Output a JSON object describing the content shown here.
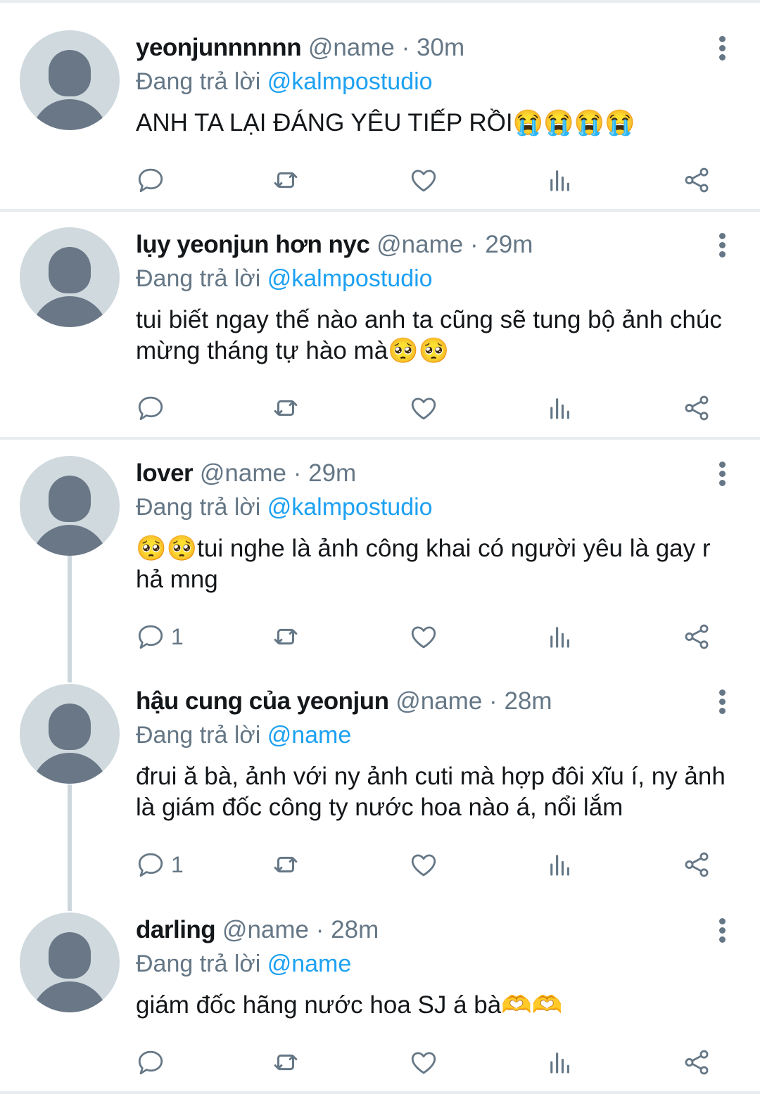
{
  "tweets": [
    {
      "name": "yeonjunnnnnn",
      "handle": "@name",
      "time": "30m",
      "reply_prefix": "Đang trả lời",
      "reply_to": "@kalmpostudio",
      "text": "ANH TA LẠI ĐÁNG YÊU TIẾP RỒI😭😭😭😭",
      "reply_count": ""
    },
    {
      "name": "lụy yeonjun hơn nyc",
      "handle": "@name",
      "time": "29m",
      "reply_prefix": "Đang trả lời",
      "reply_to": "@kalmpostudio",
      "text": "tui biết ngay thế nào anh ta cũng sẽ tung bộ ảnh chúc mừng tháng tự hào mà🥺🥺",
      "reply_count": ""
    },
    {
      "name": "lover",
      "handle": "@name",
      "time": "29m",
      "reply_prefix": "Đang trả lời",
      "reply_to": "@kalmpostudio",
      "text": "🥺🥺tui nghe là ảnh công khai có người yêu là gay r hả mng",
      "reply_count": "1"
    },
    {
      "name": "hậu cung của yeonjun",
      "handle": "@name",
      "time": "28m",
      "reply_prefix": "Đang trả lời",
      "reply_to": "@name",
      "text": "đrui ă bà, ảnh với ny ảnh cuti mà hợp đôi xĩu í, ny ảnh là giám đốc công ty nước hoa nào á, nổi lắm",
      "reply_count": "1"
    },
    {
      "name": "darling",
      "handle": "@name",
      "time": "28m",
      "reply_prefix": "Đang trả lời",
      "reply_to": "@name",
      "text": "giám đốc hãng nước hoa SJ á bà🫶🫶",
      "reply_count": ""
    }
  ],
  "separator": "·",
  "icons": [
    "reply-icon",
    "retweet-icon",
    "like-icon",
    "analytics-icon",
    "share-icon",
    "more-icon"
  ],
  "colors": {
    "accent": "#1da1f2",
    "muted": "#657786",
    "avatar_bg": "#cfd9de",
    "avatar_fg": "#697787"
  }
}
